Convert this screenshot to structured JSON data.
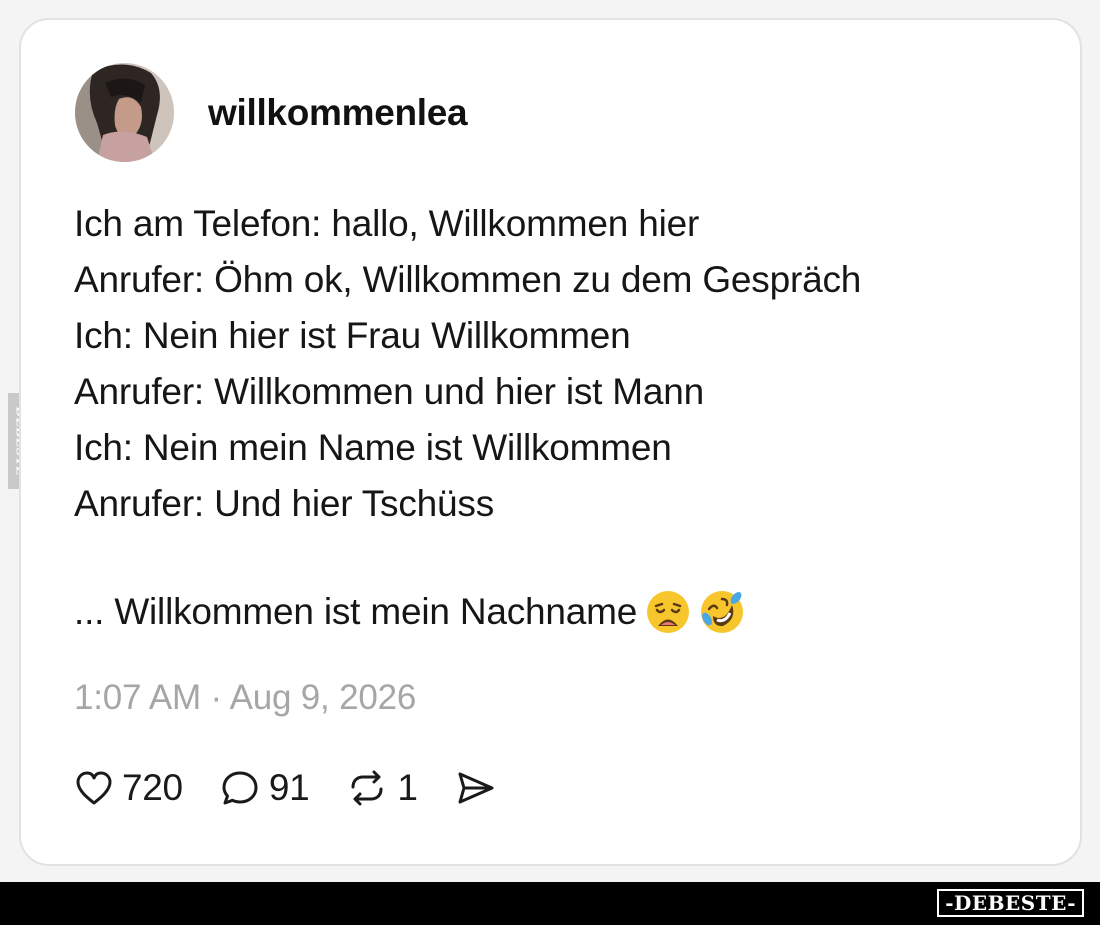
{
  "post": {
    "username": "willkommenlea",
    "lines": [
      "Ich am Telefon: hallo, Willkommen hier",
      "Anrufer: Öhm ok, Willkommen zu dem Gespräch",
      "Ich: Nein hier ist Frau Willkommen",
      "Anrufer: Willkommen und hier ist Mann",
      "Ich: Nein mein Name ist Willkommen",
      "Anrufer: Und hier Tschüss"
    ],
    "last_line": "... Willkommen ist mein Nachname",
    "emojis": [
      "weary-face-emoji",
      "rolling-on-the-floor-laughing-emoji"
    ],
    "timestamp": "1:07 AM · Aug 9, 2026"
  },
  "actions": {
    "likes": "720",
    "replies": "91",
    "reposts": "1",
    "like_icon": "heart-icon",
    "reply_icon": "comment-bubble-icon",
    "repost_icon": "repost-icon",
    "share_icon": "send-icon"
  },
  "watermark": {
    "side": "DEBESTE",
    "footer": "-DEBESTE-"
  },
  "colors": {
    "background": "#f4f4f4",
    "card": "#ffffff",
    "text": "#161616",
    "muted": "#a6a6a6",
    "footer": "#000000"
  }
}
